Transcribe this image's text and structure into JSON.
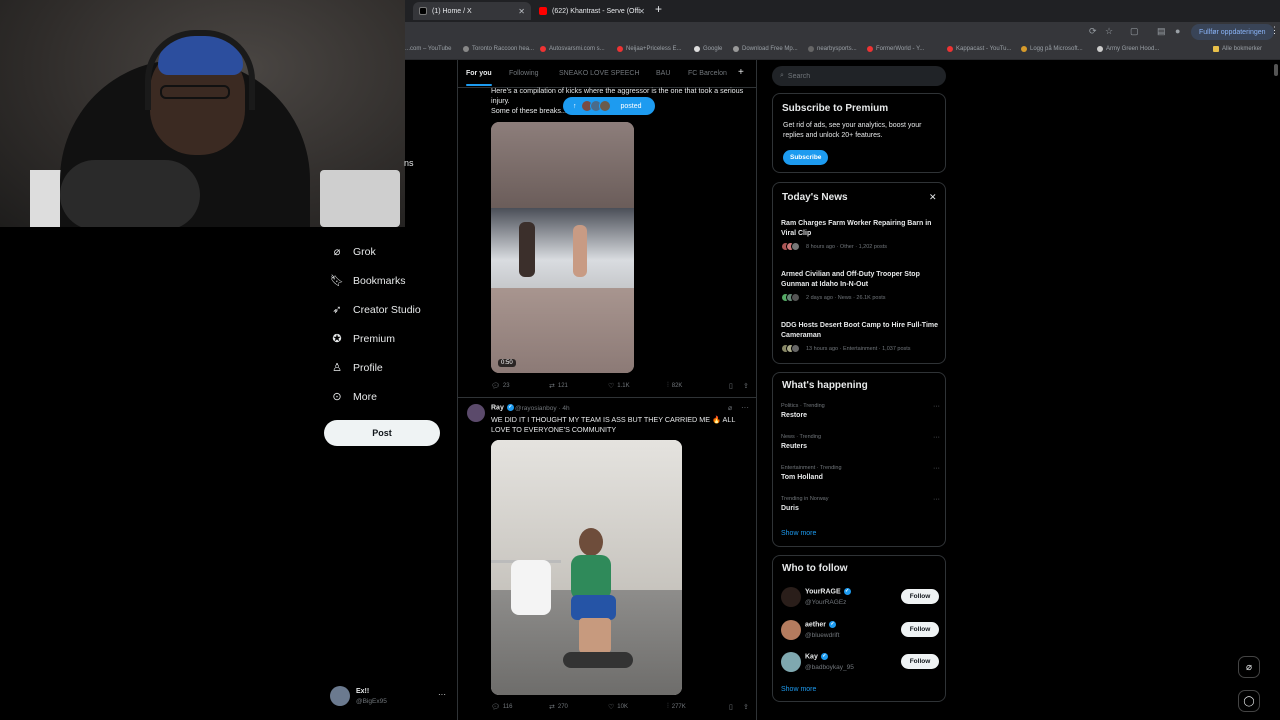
{
  "browser": {
    "tabs": [
      {
        "label": "(1) Home / X",
        "active": true
      },
      {
        "label": "(622) Khantrast - Serve (Offi",
        "active": false
      }
    ],
    "update_label": "Fullfør oppdateringen",
    "bookmarks": [
      "...com – YouTube",
      "Toronto Raccoon hea...",
      "Autosvarsmi.com s...",
      "Neijaa+Priceless E...",
      "Google",
      "Download Free Mp...",
      "nearbysports...",
      "FormerWorld - Y...",
      "Kappacast - YouTu...",
      "Logg på Microsoft...",
      "Army Green Hood...",
      "Alle bokmerker"
    ]
  },
  "colors": {
    "accent": "#1d9bf0",
    "background": "#000000",
    "border": "#2f3336",
    "muted": "#71767b"
  },
  "nav": {
    "items": [
      {
        "label": "Grok",
        "icon": "grok-icon"
      },
      {
        "label": "Bookmarks",
        "icon": "bookmark-icon"
      },
      {
        "label": "Creator Studio",
        "icon": "rocket-icon"
      },
      {
        "label": "Premium",
        "icon": "verified-icon"
      },
      {
        "label": "Profile",
        "icon": "person-icon"
      },
      {
        "label": "More",
        "icon": "more-circle-icon"
      }
    ],
    "post_label": "Post",
    "partial_text": "ns",
    "account": {
      "name": "Ex!!",
      "handle": "@BigEx95"
    }
  },
  "feed": {
    "tabs": [
      "For you",
      "Following",
      "SNEAKO LOVE SPEECH",
      "BAU",
      "FC Barcelon"
    ],
    "posted_label": "posted",
    "tweet1": {
      "text": "Here's a compilation of kicks where the aggressor is the one that took a serious injury.\nSome of these breaks...",
      "video_duration": "0:50",
      "replies": "23",
      "reposts": "121",
      "likes": "1.1K",
      "views": "82K"
    },
    "tweet2": {
      "name": "Ray",
      "handle": "@rayosianboy · 4h",
      "text": "WE DID IT I THOUGHT MY TEAM IS ASS BUT THEY CARRIED ME 🔥 ALL LOVE TO EVERYONE'S COMMUNITY",
      "replies": "116",
      "reposts": "270",
      "likes": "10K",
      "views": "277K"
    }
  },
  "sidebar": {
    "search_placeholder": "Search",
    "premium": {
      "title": "Subscribe to Premium",
      "desc": "Get rid of ads, see your analytics, boost your replies and unlock 20+ features.",
      "button": "Subscribe"
    },
    "news": {
      "title": "Today's News",
      "items": [
        {
          "headline": "Ram Charges Farm Worker Repairing Barn in Viral Clip",
          "meta": "8 hours ago · Other · 1,202 posts"
        },
        {
          "headline": "Armed Civilian and Off-Duty Trooper Stop Gunman at Idaho In-N-Out",
          "meta": "2 days ago · News · 26.1K posts"
        },
        {
          "headline": "DDG Hosts Desert Boot Camp to Hire Full-Time Cameraman",
          "meta": "13 hours ago · Entertainment · 1,037 posts"
        }
      ]
    },
    "happening": {
      "title": "What's happening",
      "trends": [
        {
          "context": "Politics · Trending",
          "name": "Restore"
        },
        {
          "context": "News · Trending",
          "name": "Reuters"
        },
        {
          "context": "Entertainment · Trending",
          "name": "Tom Holland"
        },
        {
          "context": "Trending in Norway",
          "name": "Duris"
        }
      ],
      "show_more": "Show more"
    },
    "who_to_follow": {
      "title": "Who to follow",
      "users": [
        {
          "name": "YourRAGE",
          "handle": "@YourRAGEz",
          "button": "Follow"
        },
        {
          "name": "aether",
          "handle": "@bluewdrift",
          "button": "Follow"
        },
        {
          "name": "Kay",
          "handle": "@badboykay_95",
          "button": "Follow"
        }
      ],
      "show_more": "Show more"
    }
  }
}
